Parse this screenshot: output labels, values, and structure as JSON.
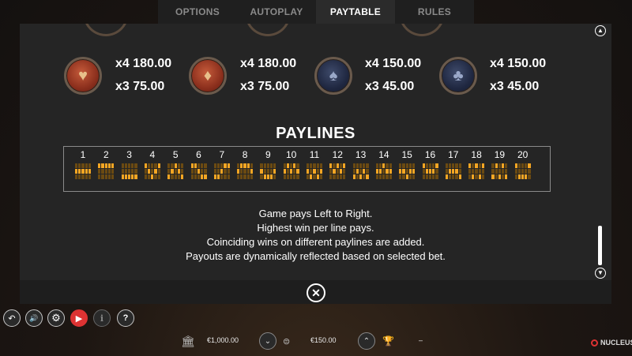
{
  "tabs": [
    {
      "label": "OPTIONS",
      "active": false
    },
    {
      "label": "AUTOPLAY",
      "active": false
    },
    {
      "label": "PAYTABLE",
      "active": true
    },
    {
      "label": "RULES",
      "active": false
    }
  ],
  "symbols": [
    {
      "icon": "heart-chip-icon",
      "color": "red",
      "glyph": "♥",
      "pays": [
        "x4 180.00",
        "x3 75.00"
      ]
    },
    {
      "icon": "diamond-chip-icon",
      "color": "red",
      "glyph": "♦",
      "pays": [
        "x4 180.00",
        "x3 75.00"
      ]
    },
    {
      "icon": "spade-chip-icon",
      "color": "blue",
      "glyph": "♠",
      "pays": [
        "x4 150.00",
        "x3 45.00"
      ]
    },
    {
      "icon": "club-chip-icon",
      "color": "blue",
      "glyph": "♣",
      "pays": [
        "x4 150.00",
        "x3 45.00"
      ]
    }
  ],
  "paylines": {
    "title": "PAYLINES",
    "numbers": [
      "1",
      "2",
      "3",
      "4",
      "5",
      "6",
      "7",
      "8",
      "9",
      "10",
      "11",
      "12",
      "13",
      "14",
      "15",
      "16",
      "17",
      "18",
      "19",
      "20"
    ],
    "patterns": [
      [
        1,
        1,
        1,
        1,
        1
      ],
      [
        0,
        0,
        0,
        0,
        0
      ],
      [
        2,
        2,
        2,
        2,
        2
      ],
      [
        0,
        1,
        2,
        1,
        0
      ],
      [
        2,
        1,
        0,
        1,
        2
      ],
      [
        0,
        0,
        1,
        2,
        2
      ],
      [
        2,
        2,
        1,
        0,
        0
      ],
      [
        1,
        0,
        0,
        0,
        1
      ],
      [
        1,
        2,
        2,
        2,
        1
      ],
      [
        1,
        0,
        1,
        0,
        1
      ],
      [
        1,
        2,
        1,
        2,
        1
      ],
      [
        0,
        1,
        0,
        1,
        0
      ],
      [
        2,
        1,
        2,
        1,
        2
      ],
      [
        1,
        1,
        0,
        1,
        1
      ],
      [
        1,
        1,
        2,
        1,
        1
      ],
      [
        0,
        1,
        1,
        1,
        0
      ],
      [
        2,
        1,
        1,
        1,
        2
      ],
      [
        0,
        2,
        0,
        2,
        0
      ],
      [
        2,
        0,
        2,
        0,
        2
      ],
      [
        0,
        2,
        2,
        2,
        0
      ]
    ]
  },
  "rules": [
    "Game pays Left to Right.",
    "Highest win per line pays.",
    "Coinciding wins on different paylines are added.",
    "Payouts are dynamically reflected based on selected bet."
  ],
  "controls": [
    {
      "icon": "back-icon",
      "glyph": "↶"
    },
    {
      "icon": "sound-icon",
      "glyph": "🔊"
    },
    {
      "icon": "settings-gear-icon",
      "glyph": "⚙"
    },
    {
      "icon": "play-icon",
      "glyph": "▶"
    },
    {
      "icon": "info-icon",
      "glyph": "i"
    },
    {
      "icon": "help-icon",
      "glyph": "?"
    }
  ],
  "bottom_bar": {
    "balance": "€1,000.00",
    "bet": "€150.00",
    "win": "–",
    "brand": "NUCLEUS"
  }
}
